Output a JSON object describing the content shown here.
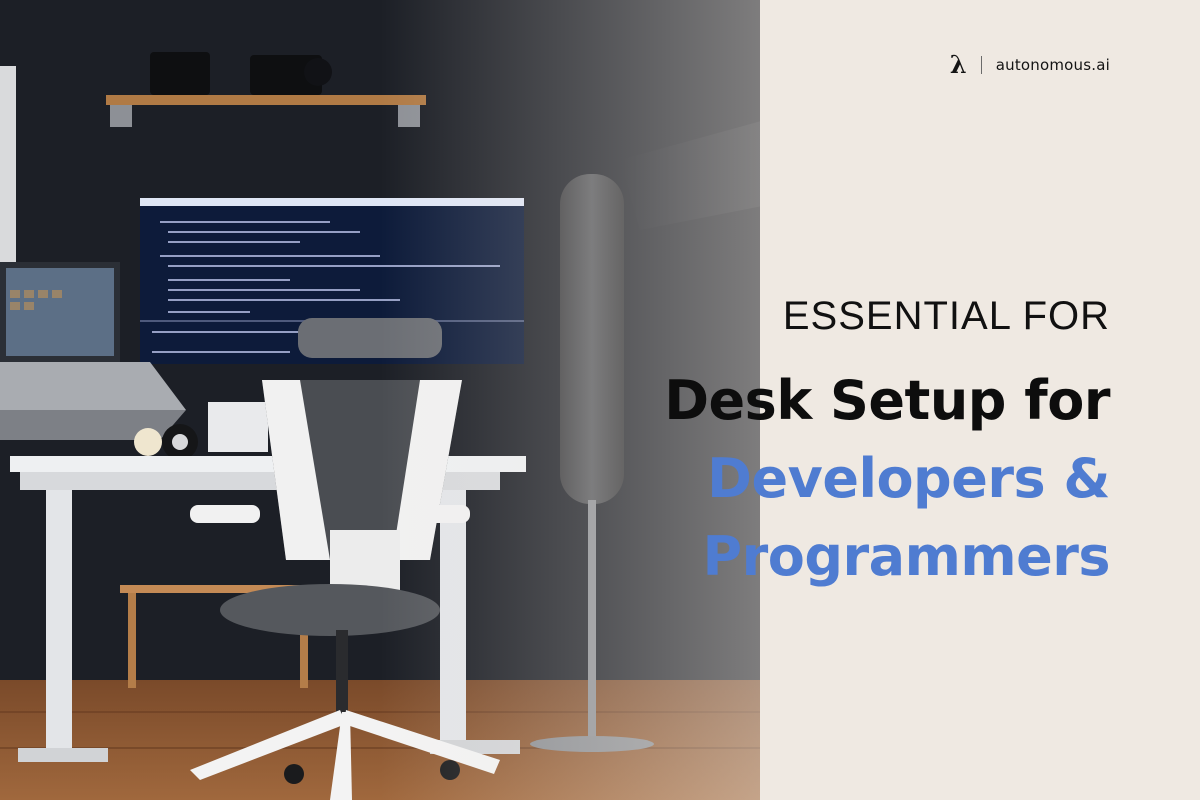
{
  "brand": {
    "logo_icon": "lambda-icon",
    "glyph": "λ",
    "name": "autonomous.ai"
  },
  "headline": {
    "kicker": "ESSENTIAL FOR",
    "line1": "Desk Setup for",
    "line2": "Developers &",
    "line3": "Programmers"
  },
  "colors": {
    "background": "#efe9e2",
    "wall": "#1c1f26",
    "accent_blue": "#4f7cd1",
    "text_dark": "#0d0d0d"
  }
}
